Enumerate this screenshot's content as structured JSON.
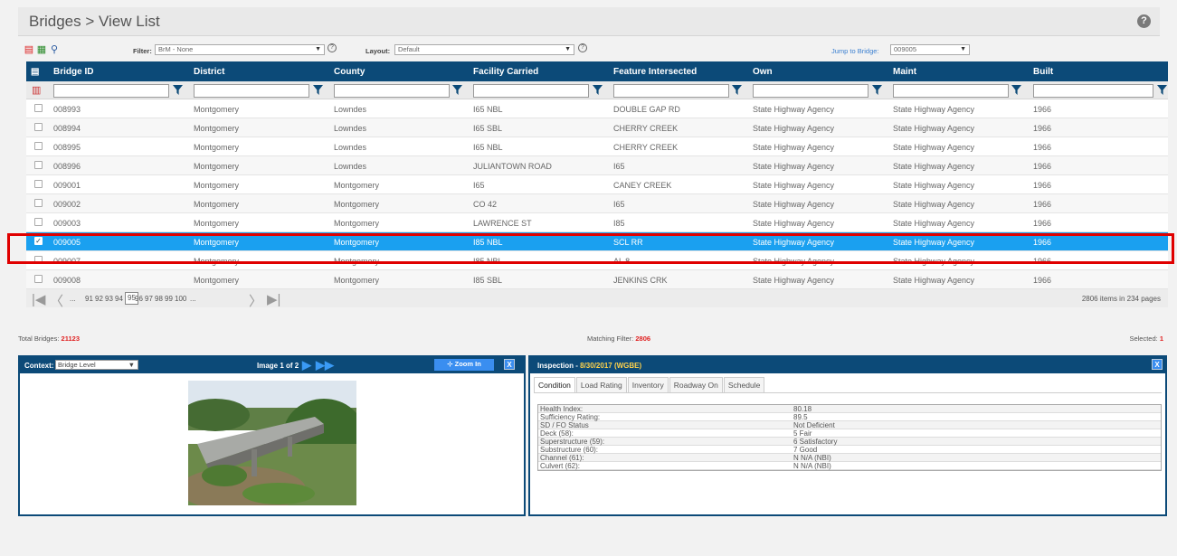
{
  "header": {
    "title": "Bridges > View List",
    "help_icon": "help-icon"
  },
  "toolbar": {
    "filter_label": "Filter:",
    "filter_value": "BrM - None",
    "layout_label": "Layout:",
    "layout_value": "Default",
    "jump_label": "Jump to Bridge:",
    "jump_value": "009005"
  },
  "grid": {
    "columns": [
      "Bridge ID",
      "District",
      "County",
      "Facility Carried",
      "Feature Intersected",
      "Own",
      "Maint",
      "Built"
    ],
    "rows": [
      {
        "id": "008993",
        "district": "Montgomery",
        "county": "Lowndes",
        "facility": "I65 NBL",
        "feature": "DOUBLE GAP RD",
        "own": "State Highway Agency",
        "maint": "State Highway Agency",
        "built": "1966"
      },
      {
        "id": "008994",
        "district": "Montgomery",
        "county": "Lowndes",
        "facility": "I65 SBL",
        "feature": "CHERRY CREEK",
        "own": "State Highway Agency",
        "maint": "State Highway Agency",
        "built": "1966"
      },
      {
        "id": "008995",
        "district": "Montgomery",
        "county": "Lowndes",
        "facility": "I65 NBL",
        "feature": "CHERRY CREEK",
        "own": "State Highway Agency",
        "maint": "State Highway Agency",
        "built": "1966"
      },
      {
        "id": "008996",
        "district": "Montgomery",
        "county": "Lowndes",
        "facility": "JULIANTOWN ROAD",
        "feature": "I65",
        "own": "State Highway Agency",
        "maint": "State Highway Agency",
        "built": "1966"
      },
      {
        "id": "009001",
        "district": "Montgomery",
        "county": "Montgomery",
        "facility": "I65",
        "feature": "CANEY CREEK",
        "own": "State Highway Agency",
        "maint": "State Highway Agency",
        "built": "1966"
      },
      {
        "id": "009002",
        "district": "Montgomery",
        "county": "Montgomery",
        "facility": "CO 42",
        "feature": "I65",
        "own": "State Highway Agency",
        "maint": "State Highway Agency",
        "built": "1966"
      },
      {
        "id": "009003",
        "district": "Montgomery",
        "county": "Montgomery",
        "facility": "LAWRENCE ST",
        "feature": "I85",
        "own": "State Highway Agency",
        "maint": "State Highway Agency",
        "built": "1966"
      },
      {
        "id": "009005",
        "district": "Montgomery",
        "county": "Montgomery",
        "facility": "I85 NBL",
        "feature": "SCL RR",
        "own": "State Highway Agency",
        "maint": "State Highway Agency",
        "built": "1966"
      },
      {
        "id": "009007",
        "district": "Montgomery",
        "county": "Montgomery",
        "facility": "I85 NBL",
        "feature": "AL 8",
        "own": "State Highway Agency",
        "maint": "State Highway Agency",
        "built": "1966"
      },
      {
        "id": "009008",
        "district": "Montgomery",
        "county": "Montgomery",
        "facility": "I85 SBL",
        "feature": "JENKINS CRK",
        "own": "State Highway Agency",
        "maint": "State Highway Agency",
        "built": "1966"
      }
    ]
  },
  "pager": {
    "pages": [
      "...",
      "91",
      "92",
      "93",
      "94",
      "95",
      "96",
      "97",
      "98",
      "99",
      "100",
      "..."
    ],
    "current": "95",
    "info": "2806 items in 234 pages"
  },
  "summary": {
    "total_label": "Total Bridges:",
    "total_value": "21123",
    "matching_label": "Matching Filter:",
    "matching_value": "2806",
    "selected_label": "Selected:",
    "selected_value": "1"
  },
  "image_panel": {
    "context_label": "Context:",
    "context_value": "Bridge Level",
    "image_counter": "Image 1 of 2",
    "zoom_label": "Zoom In",
    "close": "X"
  },
  "inspection_panel": {
    "title": "Inspection -",
    "date": "8/30/2017 (WGBE)",
    "close": "X",
    "tabs": [
      "Condition",
      "Load Rating",
      "Inventory",
      "Roadway On",
      "Schedule"
    ],
    "rows": [
      {
        "label": "Health Index:",
        "value": "80.18"
      },
      {
        "label": "Sufficiency Rating:",
        "value": "89.5"
      },
      {
        "label": "SD / FO Status",
        "value": "Not Deficient"
      },
      {
        "label": "Deck (58):",
        "value": "5 Fair"
      },
      {
        "label": "Superstructure (59):",
        "value": "6 Satisfactory"
      },
      {
        "label": "Substructure (60):",
        "value": "7 Good"
      },
      {
        "label": "Channel (61):",
        "value": "N N/A (NBI)"
      },
      {
        "label": "Culvert (62):",
        "value": "N N/A (NBI)"
      }
    ]
  },
  "colors": {
    "header_navy": "#0c4a78",
    "selected_row": "#1aa0f0",
    "highlight_box": "#e00000",
    "accent_red": "#e02020"
  }
}
